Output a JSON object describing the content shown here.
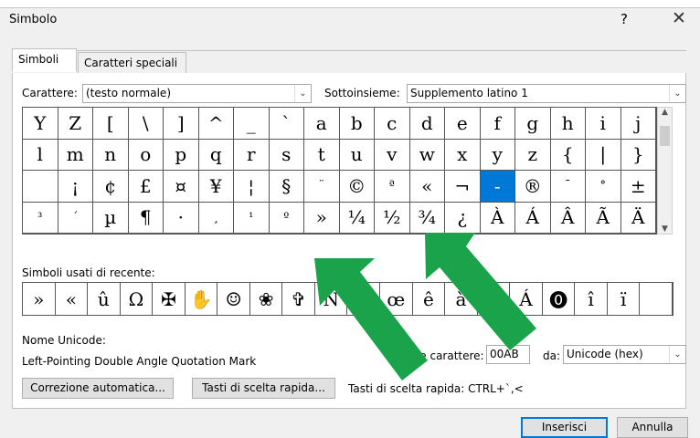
{
  "dialog": {
    "title": "Simbolo",
    "help": "?",
    "close": "✕"
  },
  "tabs": [
    {
      "label": "Simboli"
    },
    {
      "label": "Caratteri speciali"
    }
  ],
  "font": {
    "label": "Carattere:",
    "value": "(testo normale)"
  },
  "subset": {
    "label": "Sottoinsieme:",
    "value": "Supplemento latino 1"
  },
  "symbols": [
    "Y",
    "Z",
    "[",
    "\\",
    "]",
    "^",
    "_",
    "`",
    "a",
    "b",
    "c",
    "d",
    "e",
    "f",
    "g",
    "h",
    "i",
    "j",
    "k",
    "l",
    "m",
    "n",
    "o",
    "p",
    "q",
    "r",
    "s",
    "t",
    "u",
    "v",
    "w",
    "x",
    "y",
    "z",
    "{",
    "|",
    "}",
    "~",
    " ",
    "¡",
    "¢",
    "£",
    "¤",
    "¥",
    "¦",
    "§",
    "¨",
    "©",
    "ª",
    "«",
    "¬",
    "-",
    "®",
    "¯",
    "°",
    "±",
    "²",
    "³",
    "´",
    "µ",
    "¶",
    "·",
    "¸",
    "¹",
    "º",
    "»",
    "¼",
    "½",
    "¾",
    "¿",
    "À",
    "Á",
    "Â",
    "Ã",
    "Ä",
    "Å"
  ],
  "selected_index": 51,
  "recent": {
    "label": "Simboli usati di recente:",
    "items": [
      "»",
      "«",
      "û",
      "Ω",
      "✠",
      "✋",
      "☺",
      "❀",
      "✞",
      "Ñ",
      "ë",
      "œ",
      "ê",
      "à",
      "é",
      "Á",
      "⓿",
      "î",
      "ï",
      ""
    ]
  },
  "unicode": {
    "label": "Nome Unicode:",
    "name": "Left-Pointing Double Angle Quotation Mark",
    "code_label": "Codice carattere:",
    "code_value": "00AB",
    "from_label": "da:",
    "from_value": "Unicode (hex)"
  },
  "buttons": {
    "autocorrect": "Correzione automatica...",
    "shortcut": "Tasti di scelta rapida...",
    "shortcut_text": "Tasti di scelta rapida: CTRL+`,<",
    "insert": "Inserisci",
    "cancel": "Annulla"
  },
  "colors": {
    "selection": "#0078d7",
    "arrow": "#1aa34a"
  }
}
